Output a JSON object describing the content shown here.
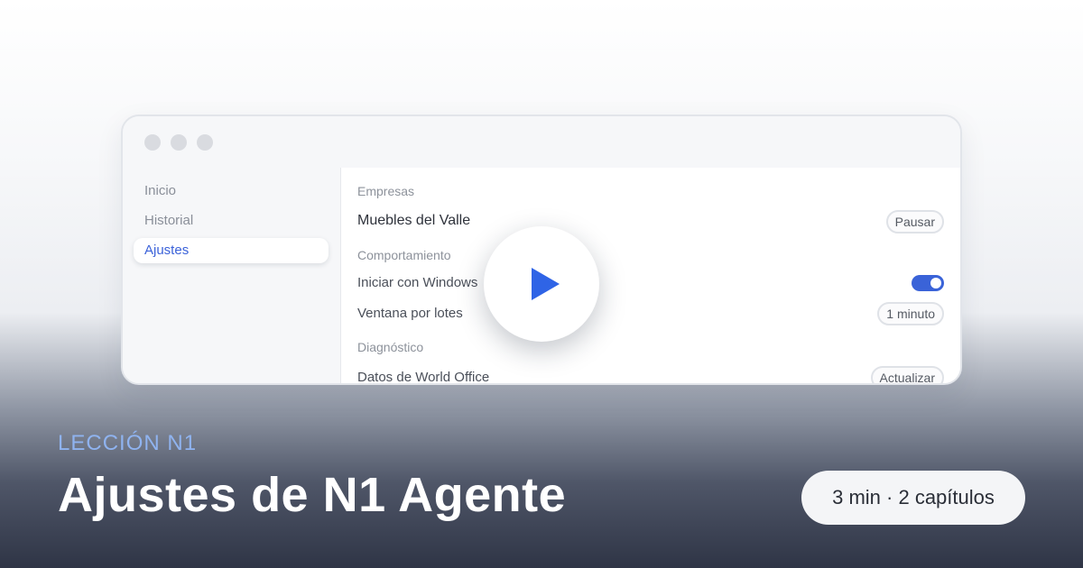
{
  "window": {
    "sidebar": {
      "items": [
        {
          "label": "Inicio",
          "active": false
        },
        {
          "label": "Historial",
          "active": false
        },
        {
          "label": "Ajustes",
          "active": true
        }
      ]
    },
    "main": {
      "sections": {
        "empresas": "Empresas",
        "comportamiento": "Comportamiento",
        "diagnostico": "Diagnóstico"
      },
      "company": {
        "name": "Muebles del Valle",
        "action": "Pausar"
      },
      "startup": {
        "label": "Iniciar con Windows",
        "enabled": true
      },
      "batch": {
        "label": "Ventana por lotes",
        "value": "1 minuto"
      },
      "data": {
        "label": "Datos de World Office",
        "action": "Actualizar"
      }
    }
  },
  "play_icon": "play-icon",
  "lesson": {
    "eyebrow": "LECCIÓN N1",
    "title": "Ajustes de N1 Agente",
    "meta": "3 min · 2 capítulos"
  },
  "colors": {
    "accent": "#3a63d8",
    "eyebrow": "#8fb3ef",
    "dark": "#2f3546"
  }
}
